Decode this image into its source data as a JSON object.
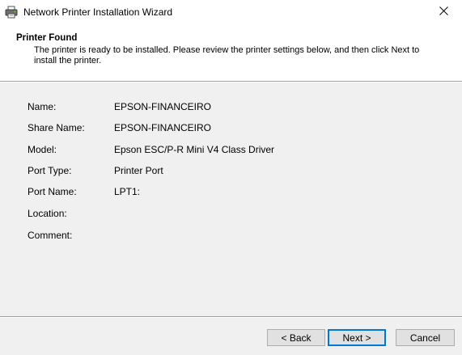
{
  "window": {
    "title": "Network Printer Installation Wizard",
    "icons": {
      "app": "printer-icon",
      "close": "close-icon"
    }
  },
  "header": {
    "title": "Printer Found",
    "description": "The printer is ready to be installed. Please review the printer settings below, and then click Next to install the printer."
  },
  "details": [
    {
      "label": "Name:",
      "value": "EPSON-FINANCEIRO"
    },
    {
      "label": "Share Name:",
      "value": "EPSON-FINANCEIRO"
    },
    {
      "label": "Model:",
      "value": "Epson ESC/P-R Mini V4 Class Driver"
    },
    {
      "label": "Port Type:",
      "value": "Printer Port"
    },
    {
      "label": "Port Name:",
      "value": "LPT1:"
    },
    {
      "label": "Location:",
      "value": ""
    },
    {
      "label": "Comment:",
      "value": ""
    }
  ],
  "buttons": {
    "back": "< Back",
    "next": "Next >",
    "cancel": "Cancel"
  },
  "colors": {
    "accent": "#0078d7",
    "panel": "#f0f0f0",
    "header": "#ffffff"
  }
}
